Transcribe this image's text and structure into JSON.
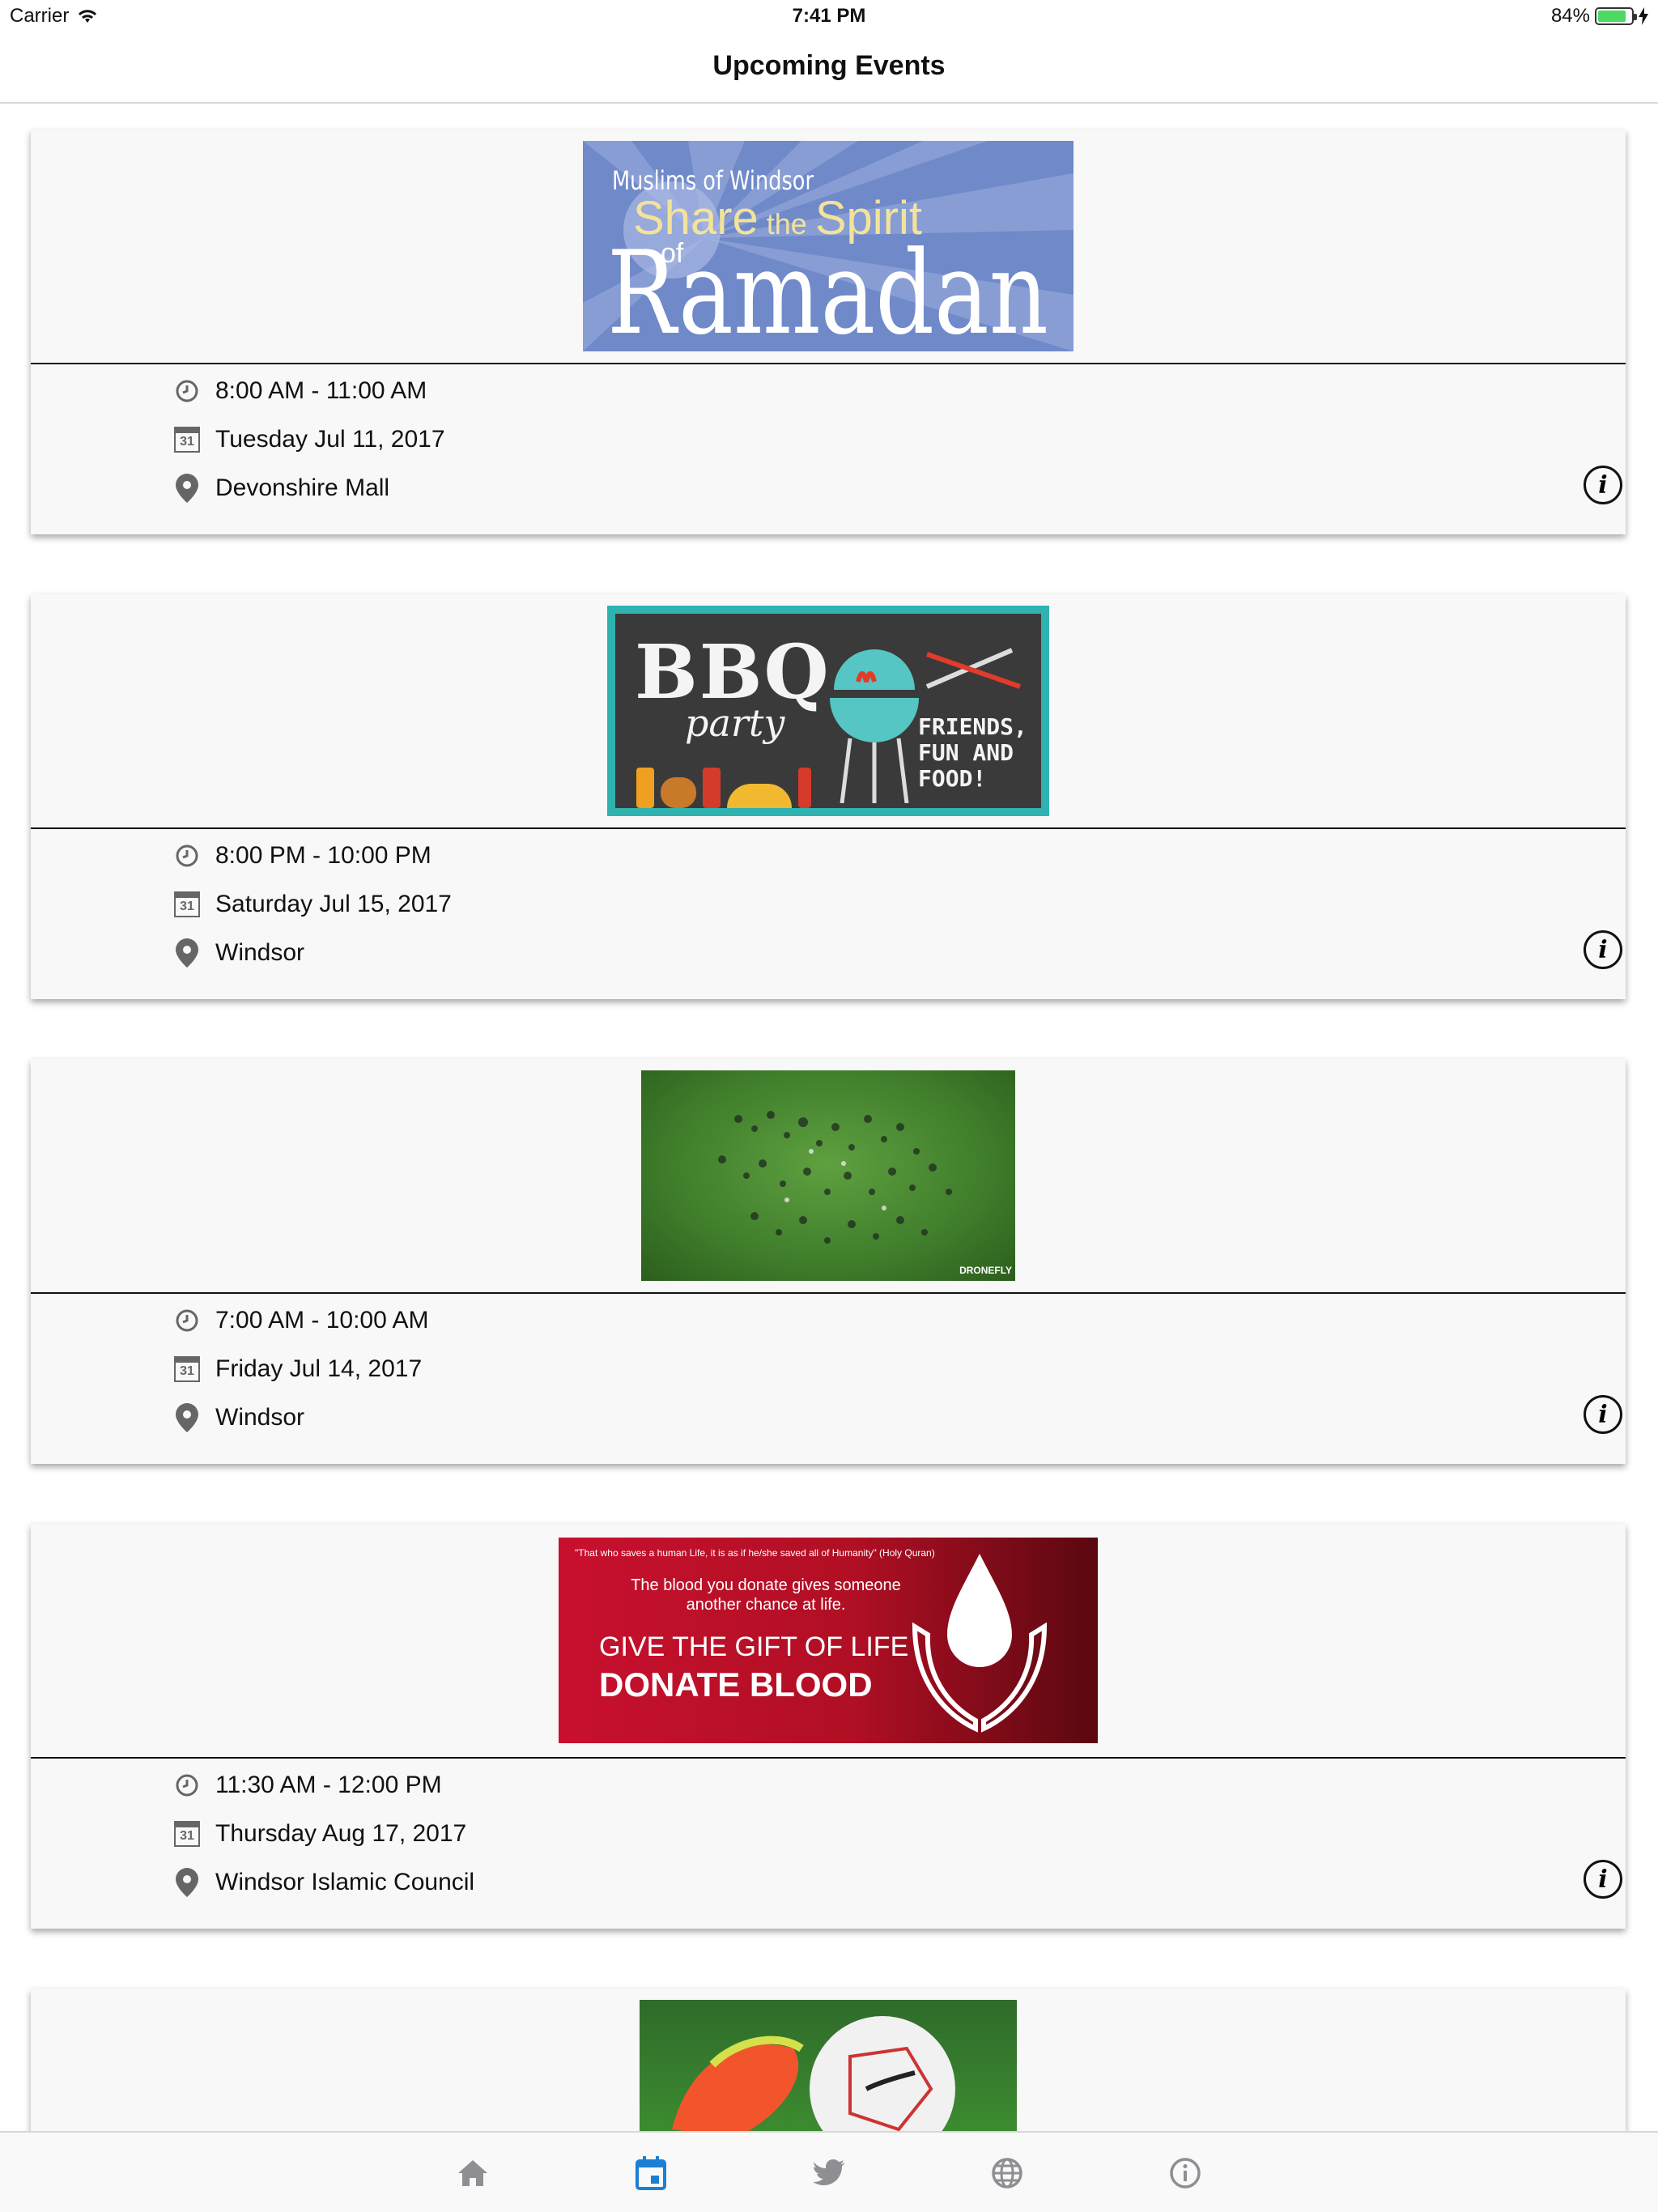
{
  "status_bar": {
    "carrier": "Carrier",
    "time": "7:41 PM",
    "battery": "84%",
    "battery_level": 0.84
  },
  "nav": {
    "title": "Upcoming Events"
  },
  "events": [
    {
      "banner": {
        "line1": "Muslims of Windsor",
        "line2a": "Share",
        "line2b": "the",
        "line2c": "Spirit",
        "line3": "of",
        "line4": "Ramadan"
      },
      "time": "8:00 AM - 11:00 AM",
      "date": "Tuesday Jul 11, 2017",
      "location": "Devonshire Mall",
      "calendar_day": "31"
    },
    {
      "banner": {
        "title": "BBQ",
        "subtitle": "party",
        "tagline": "FRIENDS, FUN AND FOOD!"
      },
      "time": "8:00 PM - 10:00 PM",
      "date": "Saturday Jul 15, 2017",
      "location": "Windsor",
      "calendar_day": "31"
    },
    {
      "banner": {
        "watermark": "DRONEFLY"
      },
      "time": "7:00 AM - 10:00 AM",
      "date": "Friday Jul 14, 2017",
      "location": "Windsor",
      "calendar_day": "31"
    },
    {
      "banner": {
        "quote": "\"That who saves a human Life, it is as if he/she saved all of Humanity\" (Holy Quran)",
        "line1": "The blood you donate gives someone",
        "line2": "another chance at life.",
        "line3": "GIVE THE GIFT OF LIFE",
        "line4": "DONATE BLOOD"
      },
      "time": "11:30 AM - 12:00 PM",
      "date": "Thursday Aug 17, 2017",
      "location": "Windsor Islamic Council",
      "calendar_day": "31"
    }
  ],
  "tabs": [
    {
      "icon": "home-icon",
      "active": false
    },
    {
      "icon": "calendar-icon",
      "active": true
    },
    {
      "icon": "twitter-icon",
      "active": false
    },
    {
      "icon": "globe-icon",
      "active": false
    },
    {
      "icon": "info-icon",
      "active": false
    }
  ],
  "colors": {
    "accent": "#1b7fd4",
    "inactive": "#8e8e93"
  }
}
